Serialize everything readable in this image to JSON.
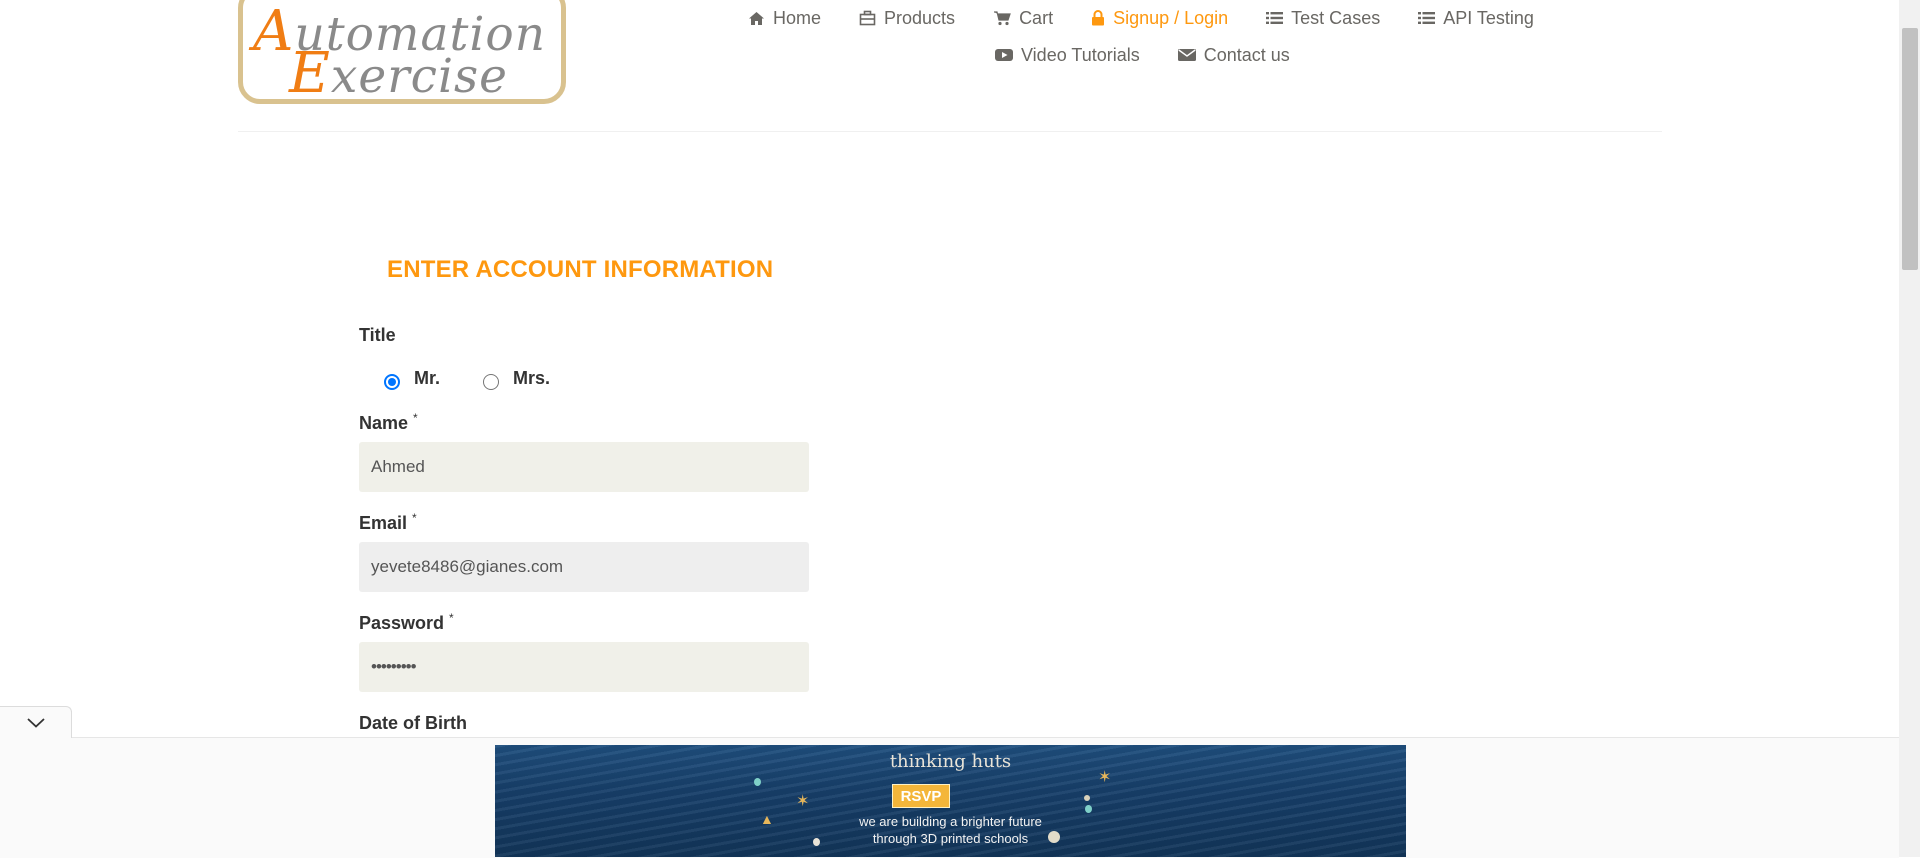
{
  "logo": {
    "line1_cap": "A",
    "line1_rest": "utomation",
    "line2_cap": "E",
    "line2_rest": "xercise"
  },
  "nav": {
    "items": [
      {
        "label": "Home",
        "icon": "home-icon"
      },
      {
        "label": "Products",
        "icon": "products-icon"
      },
      {
        "label": "Cart",
        "icon": "cart-icon"
      },
      {
        "label": "Signup / Login",
        "icon": "lock-icon",
        "active": true
      },
      {
        "label": "Test Cases",
        "icon": "list-icon"
      },
      {
        "label": "API Testing",
        "icon": "list-icon"
      },
      {
        "label": "Video Tutorials",
        "icon": "youtube-play-icon"
      },
      {
        "label": "Contact us",
        "icon": "envelope-icon"
      }
    ],
    "active_color": "#fe980f"
  },
  "form": {
    "heading": "ENTER ACCOUNT INFORMATION",
    "title_label": "Title",
    "title_options": [
      {
        "label": "Mr.",
        "checked": true
      },
      {
        "label": "Mrs.",
        "checked": false
      }
    ],
    "name_label": "Name",
    "name_value": "Ahmed",
    "email_label": "Email",
    "email_value": "yevete8486@gianes.com",
    "password_label": "Password",
    "password_value": "•••••••••",
    "dob_label": "Date of Birth",
    "required_marker": "*"
  },
  "ad": {
    "brand": "thinking huts",
    "cta": "RSVP",
    "line1": "we are building a brighter future",
    "line2": "through 3D printed schools"
  }
}
